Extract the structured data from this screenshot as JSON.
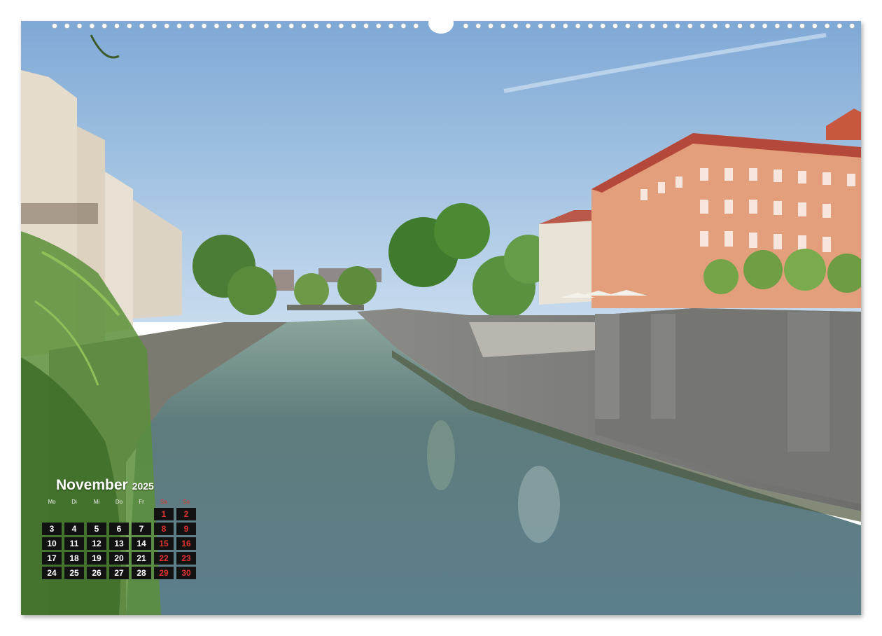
{
  "calendar": {
    "month": "November",
    "year": "2025",
    "weekdays": [
      "Mo",
      "Di",
      "Mi",
      "Do",
      "Fr",
      "Sa",
      "So"
    ],
    "weekend_columns": [
      5,
      6
    ],
    "leading_blanks": 5,
    "days": [
      "1",
      "2",
      "3",
      "4",
      "5",
      "6",
      "7",
      "8",
      "9",
      "10",
      "11",
      "12",
      "13",
      "14",
      "15",
      "16",
      "17",
      "18",
      "19",
      "20",
      "21",
      "22",
      "23",
      "24",
      "25",
      "26",
      "27",
      "28",
      "29",
      "30"
    ]
  },
  "colors": {
    "day_background": "#121212",
    "day_text": "#ffffff",
    "weekend_text": "#e0322f",
    "sky_top": "#7fa9d6",
    "water": "#5e7d86"
  },
  "photo": {
    "subject_icon": "river-cityscape-photo"
  }
}
